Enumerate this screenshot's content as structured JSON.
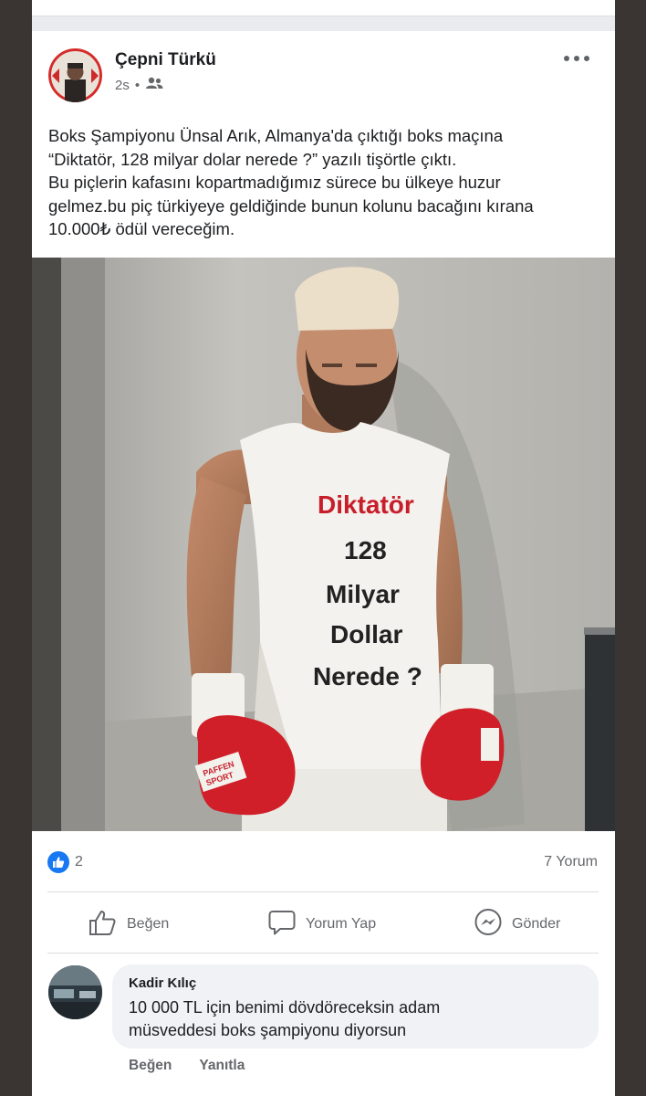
{
  "post": {
    "author": "Çepni Türkü",
    "time": "2s",
    "privacy_icon": "friends-icon",
    "text_lines": [
      "Boks Şampiyonu Ünsal Arık, Almanya'da çıktığı boks maçına",
      "“Diktatör, 128 milyar dolar nerede ?” yazılı tişörtle çıktı.",
      "Bu piçlerin kafasını kopartmadığımız sürece bu ülkeye huzur",
      "gelmez.bu piç türkiyeye geldiğinde bunun kolunu bacağını kırana",
      "10.000₺ ödül vereceğim."
    ],
    "photo": {
      "shirt_lines": [
        "Diktatör",
        "128",
        "Milyar",
        "Dollar",
        "Nerede ?"
      ],
      "glove_brand": "PAFFEN SPORT"
    }
  },
  "reactions": {
    "like_count": "2",
    "comments": "7 Yorum"
  },
  "actions": {
    "like": "Beğen",
    "comment": "Yorum Yap",
    "send": "Gönder"
  },
  "comment": {
    "author": "Kadir Kılıç",
    "text_lines": [
      "10 000 TL için benimi dövdöreceksin adam",
      "müsveddesi boks şampiyonu diyorsun"
    ],
    "like": "Beğen",
    "reply": "Yanıtla"
  },
  "colors": {
    "like_blue": "#1877f2",
    "shirt_red": "#c81e2a",
    "glove_red": "#d01f28"
  }
}
